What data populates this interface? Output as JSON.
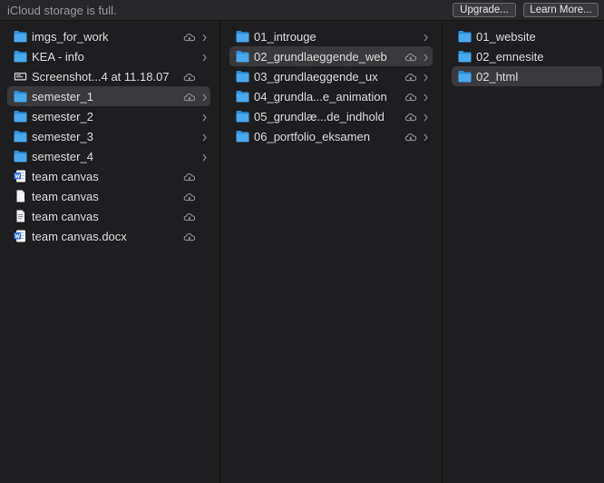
{
  "banner": {
    "message": "iCloud storage is full.",
    "upgrade_label": "Upgrade...",
    "learn_more_label": "Learn More..."
  },
  "columns": [
    {
      "items": [
        {
          "label": "imgs_for_work",
          "icon": "folder-icon",
          "cloud": true,
          "chevron": true,
          "selected": false
        },
        {
          "label": "KEA - info",
          "icon": "folder-icon",
          "cloud": false,
          "chevron": true,
          "selected": false
        },
        {
          "label": "Screenshot...4 at 11.18.07",
          "icon": "screenshot-file-icon",
          "cloud": true,
          "chevron": false,
          "selected": false
        },
        {
          "label": "semester_1",
          "icon": "folder-icon",
          "cloud": true,
          "chevron": true,
          "selected": true
        },
        {
          "label": "semester_2",
          "icon": "folder-icon",
          "cloud": false,
          "chevron": true,
          "selected": false
        },
        {
          "label": "semester_3",
          "icon": "folder-icon",
          "cloud": false,
          "chevron": true,
          "selected": false
        },
        {
          "label": "semester_4",
          "icon": "folder-icon",
          "cloud": false,
          "chevron": true,
          "selected": false
        },
        {
          "label": "team canvas",
          "icon": "word-doc-icon",
          "cloud": true,
          "chevron": false,
          "selected": false
        },
        {
          "label": "team canvas",
          "icon": "blank-doc-icon",
          "cloud": true,
          "chevron": false,
          "selected": false
        },
        {
          "label": "team canvas",
          "icon": "text-doc-icon",
          "cloud": true,
          "chevron": false,
          "selected": false
        },
        {
          "label": "team canvas.docx",
          "icon": "word-doc-icon",
          "cloud": true,
          "chevron": false,
          "selected": false
        }
      ]
    },
    {
      "items": [
        {
          "label": "01_introuge",
          "icon": "folder-icon",
          "cloud": false,
          "chevron": true,
          "selected": false
        },
        {
          "label": "02_grundlaeggende_web",
          "icon": "folder-icon",
          "cloud": true,
          "chevron": true,
          "selected": true
        },
        {
          "label": "03_grundlaeggende_ux",
          "icon": "folder-icon",
          "cloud": true,
          "chevron": true,
          "selected": false
        },
        {
          "label": "04_grundla...e_animation",
          "icon": "folder-icon",
          "cloud": true,
          "chevron": true,
          "selected": false
        },
        {
          "label": "05_grundlæ...de_indhold",
          "icon": "folder-icon",
          "cloud": true,
          "chevron": true,
          "selected": false
        },
        {
          "label": "06_portfolio_eksamen",
          "icon": "folder-icon",
          "cloud": true,
          "chevron": true,
          "selected": false
        }
      ]
    },
    {
      "items": [
        {
          "label": "01_website",
          "icon": "folder-icon",
          "cloud": false,
          "chevron": false,
          "selected": false
        },
        {
          "label": "02_emnesite",
          "icon": "folder-icon",
          "cloud": false,
          "chevron": false,
          "selected": false
        },
        {
          "label": "02_html",
          "icon": "folder-icon",
          "cloud": false,
          "chevron": false,
          "selected": true
        }
      ]
    }
  ],
  "colors": {
    "background": "#1e1e20",
    "selection": "#3a3a3c",
    "folder": "#4aa8ef",
    "text": "#dedee0"
  }
}
